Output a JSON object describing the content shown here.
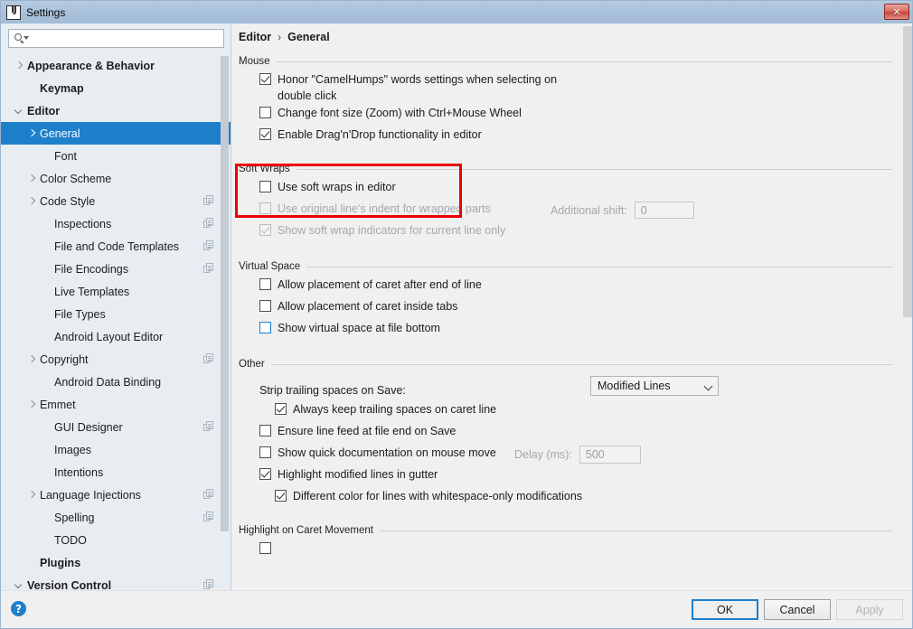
{
  "window": {
    "title": "Settings",
    "app_icon": "intellij-idea-icon",
    "close_label": "✕"
  },
  "search": {
    "value": "",
    "placeholder": ""
  },
  "sidebar": {
    "items": [
      {
        "label": "Appearance & Behavior",
        "arrow": "closed",
        "bold": true,
        "indent": 0,
        "copy": false,
        "selected": false
      },
      {
        "label": "Keymap",
        "arrow": "none",
        "bold": true,
        "indent": 1,
        "copy": false,
        "selected": false
      },
      {
        "label": "Editor",
        "arrow": "open",
        "bold": true,
        "indent": 0,
        "copy": false,
        "selected": false
      },
      {
        "label": "General",
        "arrow": "closed",
        "bold": false,
        "indent": 1,
        "copy": false,
        "selected": true
      },
      {
        "label": "Font",
        "arrow": "none",
        "bold": false,
        "indent": 2,
        "copy": false,
        "selected": false
      },
      {
        "label": "Color Scheme",
        "arrow": "closed",
        "bold": false,
        "indent": 1,
        "copy": false,
        "selected": false
      },
      {
        "label": "Code Style",
        "arrow": "closed",
        "bold": false,
        "indent": 1,
        "copy": true,
        "selected": false
      },
      {
        "label": "Inspections",
        "arrow": "none",
        "bold": false,
        "indent": 2,
        "copy": true,
        "selected": false
      },
      {
        "label": "File and Code Templates",
        "arrow": "none",
        "bold": false,
        "indent": 2,
        "copy": true,
        "selected": false
      },
      {
        "label": "File Encodings",
        "arrow": "none",
        "bold": false,
        "indent": 2,
        "copy": true,
        "selected": false
      },
      {
        "label": "Live Templates",
        "arrow": "none",
        "bold": false,
        "indent": 2,
        "copy": false,
        "selected": false
      },
      {
        "label": "File Types",
        "arrow": "none",
        "bold": false,
        "indent": 2,
        "copy": false,
        "selected": false
      },
      {
        "label": "Android Layout Editor",
        "arrow": "none",
        "bold": false,
        "indent": 2,
        "copy": false,
        "selected": false
      },
      {
        "label": "Copyright",
        "arrow": "closed",
        "bold": false,
        "indent": 1,
        "copy": true,
        "selected": false
      },
      {
        "label": "Android Data Binding",
        "arrow": "none",
        "bold": false,
        "indent": 2,
        "copy": false,
        "selected": false
      },
      {
        "label": "Emmet",
        "arrow": "closed",
        "bold": false,
        "indent": 1,
        "copy": false,
        "selected": false
      },
      {
        "label": "GUI Designer",
        "arrow": "none",
        "bold": false,
        "indent": 2,
        "copy": true,
        "selected": false
      },
      {
        "label": "Images",
        "arrow": "none",
        "bold": false,
        "indent": 2,
        "copy": false,
        "selected": false
      },
      {
        "label": "Intentions",
        "arrow": "none",
        "bold": false,
        "indent": 2,
        "copy": false,
        "selected": false
      },
      {
        "label": "Language Injections",
        "arrow": "closed",
        "bold": false,
        "indent": 1,
        "copy": true,
        "selected": false
      },
      {
        "label": "Spelling",
        "arrow": "none",
        "bold": false,
        "indent": 2,
        "copy": true,
        "selected": false
      },
      {
        "label": "TODO",
        "arrow": "none",
        "bold": false,
        "indent": 2,
        "copy": false,
        "selected": false
      },
      {
        "label": "Plugins",
        "arrow": "none",
        "bold": true,
        "indent": 1,
        "copy": false,
        "selected": false
      },
      {
        "label": "Version Control",
        "arrow": "open",
        "bold": true,
        "indent": 0,
        "copy": true,
        "selected": false
      }
    ]
  },
  "breadcrumb": {
    "parent": "Editor",
    "separator": "›",
    "current": "General"
  },
  "main": {
    "groups": [
      {
        "title": "Mouse"
      },
      {
        "title": "Soft Wraps"
      },
      {
        "title": "Virtual Space"
      },
      {
        "title": "Other"
      },
      {
        "title": "Highlight on Caret Movement"
      }
    ],
    "mouse": {
      "honor_camelhumps": "Honor \"CamelHumps\" words settings when selecting on double click",
      "change_font_size": "Change font size (Zoom) with Ctrl+Mouse Wheel",
      "enable_dragndrop": "Enable Drag'n'Drop functionality in editor"
    },
    "soft_wraps": {
      "use_soft_wraps": "Use soft wraps in editor",
      "use_original_indent": "Use original line's indent for wrapped parts",
      "show_indicators": "Show soft wrap indicators for current line only",
      "additional_shift_label": "Additional shift:",
      "additional_shift_value": "0"
    },
    "virtual_space": {
      "caret_after_eol": "Allow placement of caret after end of line",
      "caret_inside_tabs": "Allow placement of caret inside tabs",
      "virtual_space_bottom": "Show virtual space at file bottom"
    },
    "other": {
      "strip_trailing_label": "Strip trailing spaces on Save:",
      "strip_trailing_value": "Modified Lines",
      "always_keep_trailing": "Always keep trailing spaces on caret line",
      "ensure_line_feed": "Ensure line feed at file end on Save",
      "show_quick_doc": "Show quick documentation on mouse move",
      "delay_label": "Delay (ms):",
      "delay_value": "500",
      "highlight_modified": "Highlight modified lines in gutter",
      "different_color": "Different color for lines with whitespace-only modifications"
    }
  },
  "footer": {
    "help": "?",
    "ok": "OK",
    "cancel": "Cancel",
    "apply": "Apply"
  },
  "colors": {
    "accent": "#1e7fcb",
    "annotation": "#ee0000",
    "titlebar": "#a9c1da",
    "sidebar_bg": "#e8edf2",
    "panel_bg": "#f0f0f0"
  }
}
